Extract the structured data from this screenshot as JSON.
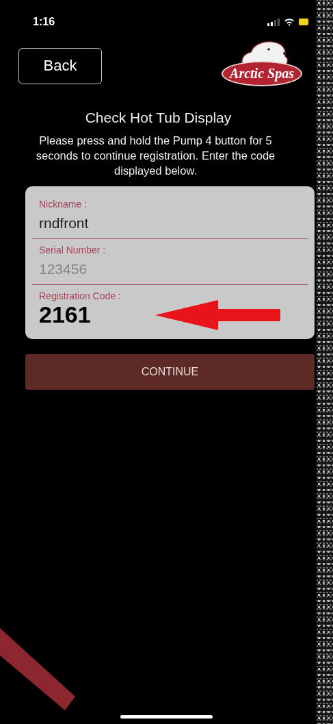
{
  "status_bar": {
    "time": "1:16"
  },
  "header": {
    "back_button": "Back",
    "logo_text": "Arctic Spas"
  },
  "title": "Check Hot Tub Display",
  "instructions": "Please press and hold the Pump 4 button for 5 seconds to continue registration. Enter the code displayed below.",
  "form": {
    "fields": [
      {
        "label": "Nickname :",
        "value": "rndfront"
      },
      {
        "label": "Serial Number :",
        "placeholder": "123456"
      },
      {
        "label": "Registration Code :",
        "value": "2161",
        "kind": "code"
      }
    ]
  },
  "continue_button": "CONTINUE"
}
